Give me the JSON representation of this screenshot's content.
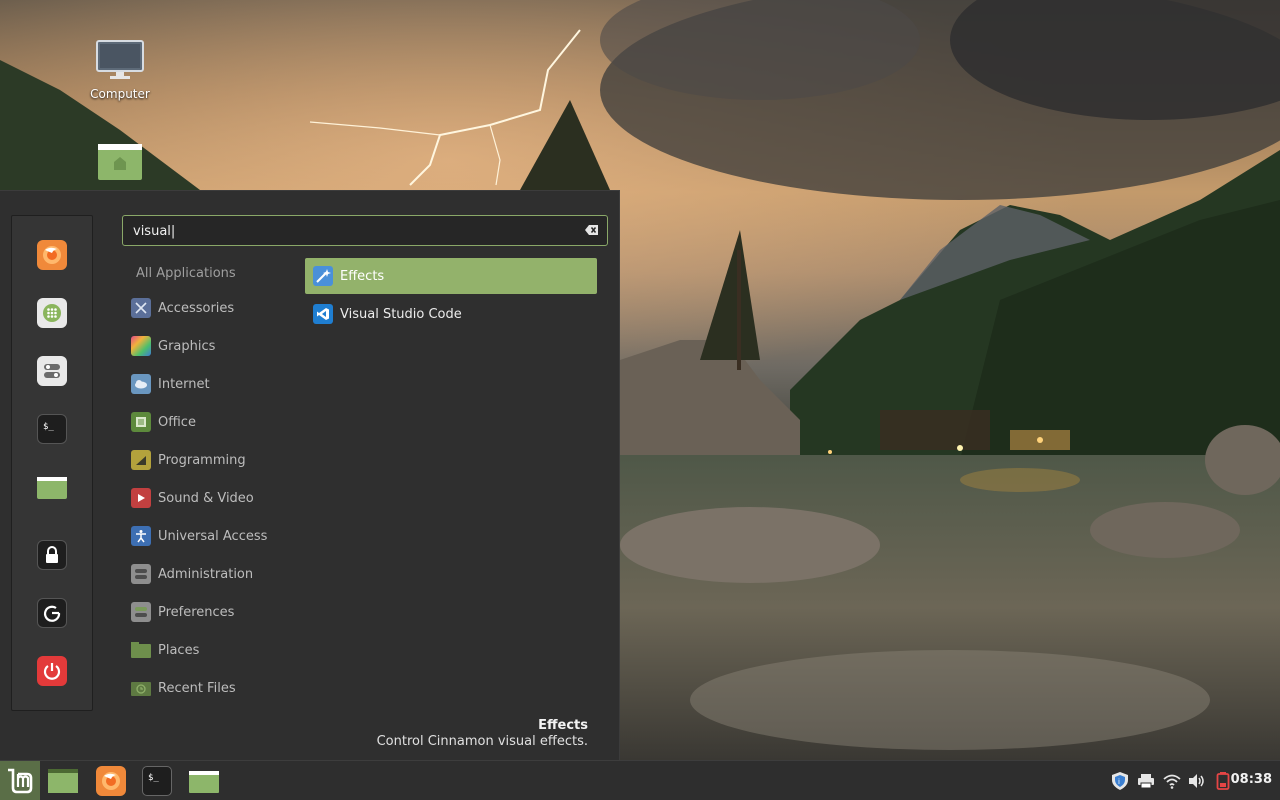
{
  "desktop": {
    "icons": [
      {
        "label": "Computer",
        "icon": "computer-icon"
      },
      {
        "label": "",
        "icon": "home-folder-icon"
      }
    ]
  },
  "menu": {
    "favorites": [
      {
        "name": "Firefox",
        "icon": "firefox-icon"
      },
      {
        "name": "Software Manager",
        "icon": "software-manager-icon"
      },
      {
        "name": "System Settings",
        "icon": "settings-toggle-icon"
      },
      {
        "name": "Terminal",
        "icon": "terminal-icon"
      },
      {
        "name": "Files",
        "icon": "folder-icon"
      },
      {
        "name": "Lock Screen",
        "icon": "lock-icon"
      },
      {
        "name": "Logout",
        "icon": "logout-icon"
      },
      {
        "name": "Quit",
        "icon": "power-icon"
      }
    ],
    "search": {
      "value": "visual|"
    },
    "categories": [
      {
        "label": "All Applications"
      },
      {
        "label": "Accessories",
        "icon": "accessories-icon",
        "color": "#5b6f99"
      },
      {
        "label": "Graphics",
        "icon": "graphics-icon",
        "color": "#c9479a"
      },
      {
        "label": "Internet",
        "icon": "internet-icon",
        "color": "#6a97c0"
      },
      {
        "label": "Office",
        "icon": "office-icon",
        "color": "#5d8a3c"
      },
      {
        "label": "Programming",
        "icon": "programming-icon",
        "color": "#b3a23c"
      },
      {
        "label": "Sound & Video",
        "icon": "sound-video-icon",
        "color": "#c24040"
      },
      {
        "label": "Universal Access",
        "icon": "universal-access-icon",
        "color": "#3d6fb3"
      },
      {
        "label": "Administration",
        "icon": "administration-icon",
        "color": "#8e8e8e"
      },
      {
        "label": "Preferences",
        "icon": "preferences-icon",
        "color": "#7a9a5a"
      },
      {
        "label": "Places",
        "icon": "places-folder-icon",
        "color": "#6e8f4c"
      },
      {
        "label": "Recent Files",
        "icon": "recent-files-icon",
        "color": "#6e8f4c"
      }
    ],
    "results": [
      {
        "label": "Effects",
        "icon": "effects-icon",
        "selected": true
      },
      {
        "label": "Visual Studio Code",
        "icon": "vscode-icon",
        "selected": false
      }
    ],
    "description": {
      "title": "Effects",
      "text": "Control Cinnamon visual effects."
    }
  },
  "panel": {
    "launchers": [
      {
        "name": "Menu",
        "icon": "mint-logo-icon"
      },
      {
        "name": "Show Desktop",
        "icon": "show-desktop-icon"
      },
      {
        "name": "Firefox",
        "icon": "firefox-icon"
      },
      {
        "name": "Terminal",
        "icon": "terminal-icon"
      },
      {
        "name": "Files",
        "icon": "folder-icon"
      }
    ],
    "tray": [
      "shield-icon",
      "printer-icon",
      "wifi-icon",
      "volume-icon",
      "battery-icon"
    ],
    "clock": "08:38"
  },
  "colors": {
    "accent": "#93b26b",
    "menu_bg": "#2f2f2f",
    "panel_bg": "#2e2e2e",
    "mint_green": "#8aa868"
  }
}
